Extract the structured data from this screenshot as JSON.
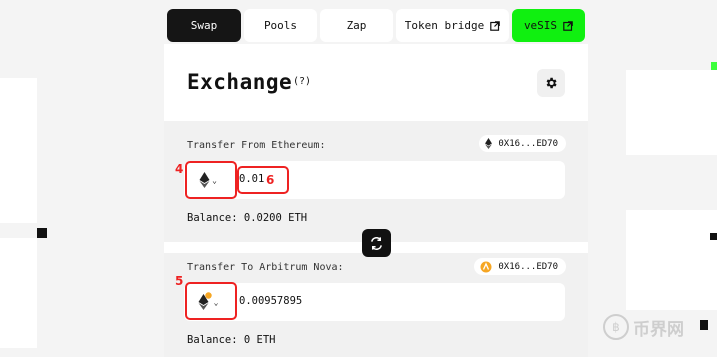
{
  "nav": {
    "tabs": [
      {
        "label": "Swap",
        "active": true
      },
      {
        "label": "Pools"
      },
      {
        "label": "Zap"
      },
      {
        "label": "Token bridge",
        "icon": "external-link-icon"
      },
      {
        "label": "veSIS",
        "icon": "external-link-icon"
      }
    ]
  },
  "header": {
    "title": "Exchange",
    "help": "(?)"
  },
  "from": {
    "label": "Transfer From Ethereum:",
    "address": "0X16...ED70",
    "token_icon": "ethereum-icon",
    "amount": "0.01",
    "balance": "Balance: 0.0200 ETH"
  },
  "to": {
    "label": "Transfer To Arbitrum Nova:",
    "address": "0X16...ED70",
    "token_icon": "ethereum-icon",
    "amount": "0.00957895",
    "balance": "Balance: 0 ETH"
  },
  "annotations": [
    "4",
    "6",
    "5"
  ],
  "watermark": "币界网",
  "colors": {
    "accent_green": "#10f010",
    "dark": "#151515",
    "annotation_red": "#ee2222"
  }
}
